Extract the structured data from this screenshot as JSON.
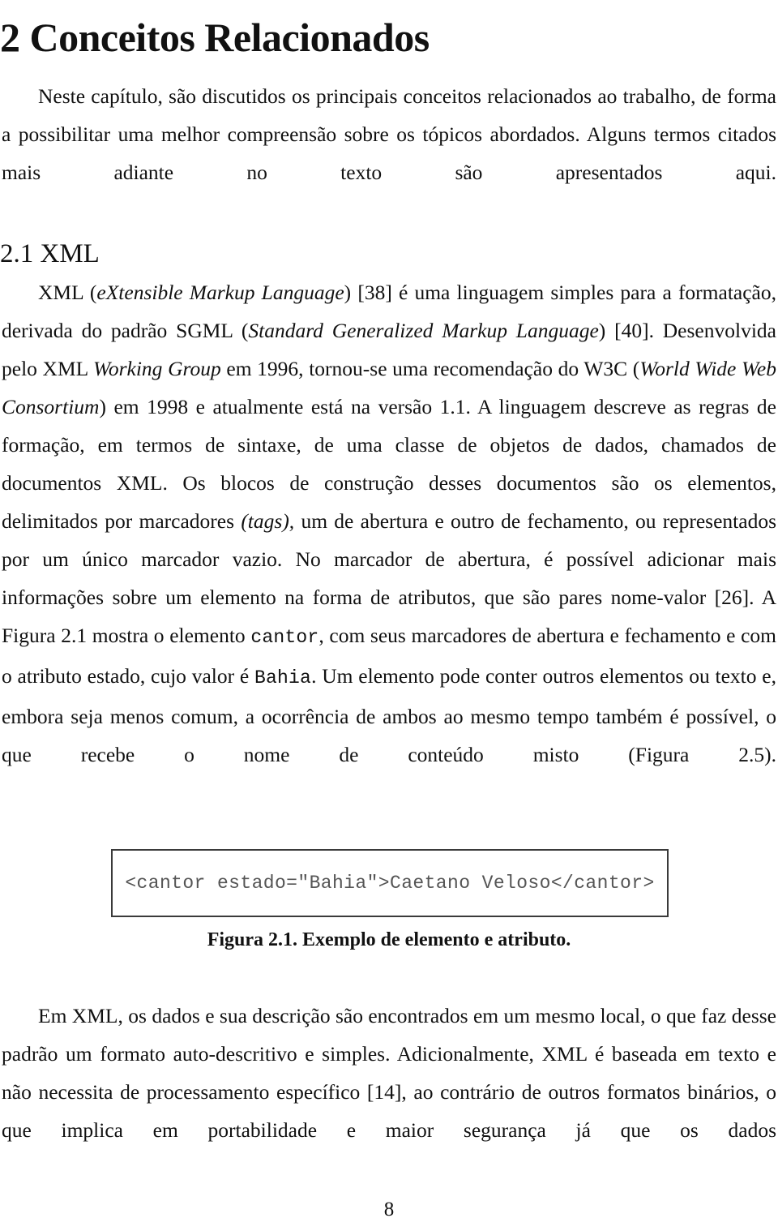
{
  "document": {
    "chapter_title": "2 Conceitos Relacionados",
    "page_number": "8"
  },
  "intro_paragraph": {
    "text": "Neste capítulo, são discutidos os principais conceitos relacionados ao trabalho, de forma a possibilitar uma melhor compreensão sobre os tópicos abordados. Alguns termos citados mais adiante no texto são apresentados aqui."
  },
  "section": {
    "heading": "2.1 XML"
  },
  "xml_paragraph": {
    "seg1": "XML (",
    "seg2_italic": "eXtensible Markup Language",
    "seg3": ") [38] é uma linguagem simples para a formatação, derivada do padrão SGML (",
    "seg4_italic": "Standard Generalized Markup Language",
    "seg5": ") [40]. Desenvolvida pelo XML ",
    "seg6_italic": "Working Group",
    "seg7": " em 1996, tornou-se uma recomendação do W3C (",
    "seg8_italic": "World Wide Web Consortium",
    "seg9": ") em 1998 e atualmente está na versão 1.1. A linguagem descreve as regras de formação, em termos de sintaxe, de uma classe de objetos de dados, chamados de documentos XML. Os blocos de construção desses documentos são os elementos, delimitados por marcadores ",
    "seg10_italic": "(tags),",
    "seg11": " um de abertura e outro de fechamento, ou representados por um único marcador vazio. No marcador de abertura, é possível adicionar mais informações sobre um elemento na forma de atributos, que são pares nome-valor [26]. A Figura 2.1 mostra o elemento ",
    "seg12_mono": "cantor",
    "seg13": ", com seus marcadores de abertura e fechamento e com o atributo estado, cujo valor é ",
    "seg14_mono": "Bahia",
    "seg15": ". Um elemento pode conter outros elementos ou texto e, embora seja menos comum, a ocorrência de ambos ao mesmo tempo também é possível, o que recebe o nome de conteúdo misto (Figura 2.5)."
  },
  "figure": {
    "code": "<cantor estado=″Bahia″>Caetano Veloso</cantor>",
    "caption": "Figura 2.1. Exemplo de elemento e atributo."
  },
  "closing_paragraph": {
    "text": "Em XML, os dados e sua descrição são encontrados em um mesmo local, o que faz desse padrão um formato auto-descritivo e simples. Adicionalmente, XML é baseada em texto e não necessita de processamento específico [14], ao contrário de outros formatos binários, o que implica em portabilidade e maior segurança já que os dados"
  },
  "colors": {
    "text": "#111111",
    "code_text": "#555555",
    "box_border": "#3a3a3a",
    "page_background": "#ffffff"
  }
}
